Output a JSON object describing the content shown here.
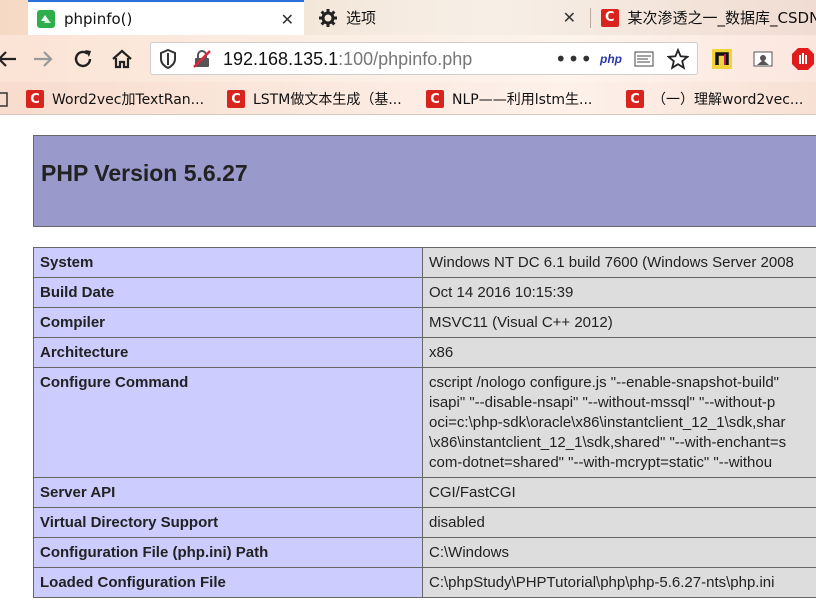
{
  "browser": {
    "tabs": [
      {
        "label": "phpinfo()",
        "icon": "page-icon",
        "active": true
      },
      {
        "label": "选项",
        "icon": "gear-icon",
        "active": false
      },
      {
        "label": "某次渗透之一_数据库_CSDN",
        "icon": "csdn-icon",
        "active": false
      }
    ],
    "url": {
      "host": "192.168.135.1",
      "rest": ":100/phpinfo.php"
    },
    "toolbar_icons": [
      "back-icon",
      "forward-icon",
      "reload-icon",
      "home-icon",
      "shield-icon",
      "insecure-lock-icon",
      "more-icon",
      "php-extension-icon",
      "hackbar-icon",
      "star-icon",
      "extension-n-icon",
      "extension-tool-icon",
      "adblock-icon"
    ],
    "php_ext_label": "php",
    "csdn_glyph": "C",
    "bookmarks": [
      {
        "label": "Word2vec加TextRan..."
      },
      {
        "label": "LSTM做文本生成（基..."
      },
      {
        "label": "NLP——利用lstm生..."
      },
      {
        "label": "（一）理解word2vec..."
      }
    ]
  },
  "page": {
    "title": "PHP Version 5.6.27",
    "rows": [
      {
        "key": "System",
        "value": [
          "Windows NT DC 6.1 build 7600 (Windows Server 2008"
        ]
      },
      {
        "key": "Build Date",
        "value": [
          "Oct 14 2016 10:15:39"
        ]
      },
      {
        "key": "Compiler",
        "value": [
          "MSVC11 (Visual C++ 2012)"
        ]
      },
      {
        "key": "Architecture",
        "value": [
          "x86"
        ]
      },
      {
        "key": "Configure Command",
        "value": [
          "cscript /nologo configure.js \"--enable-snapshot-build\"",
          "isapi\" \"--disable-nsapi\" \"--without-mssql\" \"--without-p",
          "oci=c:\\php-sdk\\oracle\\x86\\instantclient_12_1\\sdk,shar",
          "\\x86\\instantclient_12_1\\sdk,shared\" \"--with-enchant=s",
          "com-dotnet=shared\" \"--with-mcrypt=static\" \"--withou"
        ]
      },
      {
        "key": "Server API",
        "value": [
          "CGI/FastCGI"
        ]
      },
      {
        "key": "Virtual Directory Support",
        "value": [
          "disabled"
        ]
      },
      {
        "key": "Configuration File (php.ini) Path",
        "value": [
          "C:\\Windows"
        ]
      },
      {
        "key": "Loaded Configuration File",
        "value": [
          "C:\\phpStudy\\PHPTutorial\\php\\php-5.6.27-nts\\php.ini"
        ]
      }
    ]
  },
  "colors": {
    "header_bg": "#9999cc",
    "key_bg": "#ccccff",
    "value_bg": "#dddddd"
  }
}
